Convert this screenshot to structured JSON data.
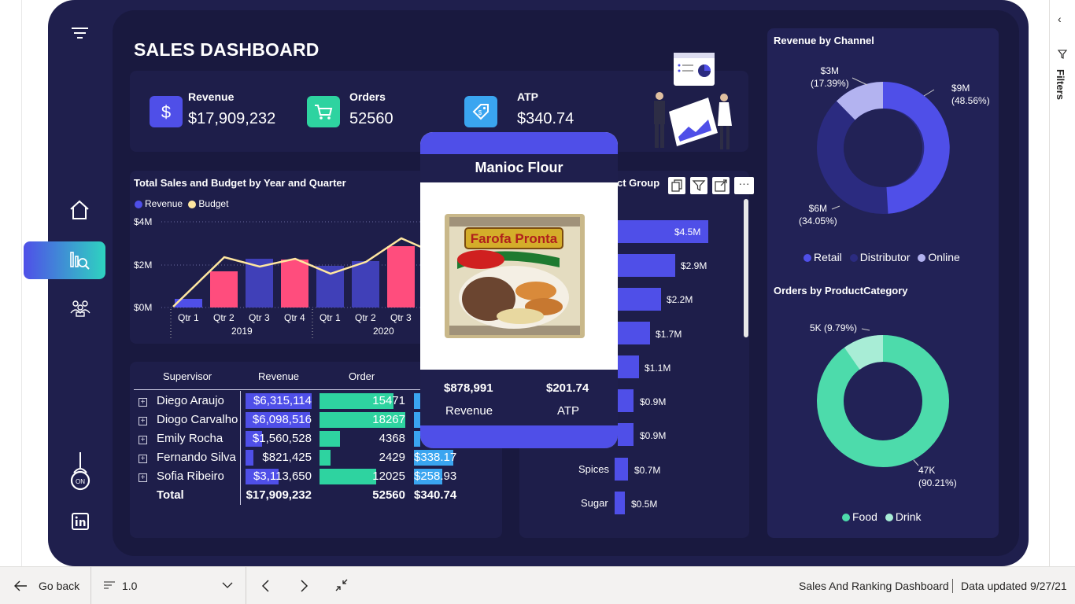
{
  "page": {
    "title": "SALES DASHBOARD"
  },
  "kpis": [
    {
      "label": "Revenue",
      "value": "$17,909,232",
      "icon": "dollar-icon",
      "color": "#4f4fe8"
    },
    {
      "label": "Orders",
      "value": "52560",
      "icon": "cart-icon",
      "color": "#2ed3a0"
    },
    {
      "label": "ATP",
      "value": "$340.74",
      "icon": "price-tag-icon",
      "color": "#3aa5f0"
    }
  ],
  "sales_chart": {
    "title": "Total Sales and Budget by Year and Quarter",
    "legend": [
      "Revenue",
      "Budget"
    ],
    "y_ticks": [
      "$4M",
      "$2M",
      "$0M"
    ],
    "quarters": [
      "Qtr 1",
      "Qtr 2",
      "Qtr 3",
      "Qtr 4",
      "Qtr 1",
      "Qtr 2",
      "Qtr 3"
    ],
    "years": [
      "2019",
      "2020"
    ]
  },
  "product_chart": {
    "title_partial": "ct Group",
    "categories": [
      "",
      "",
      "",
      "",
      "",
      "",
      "",
      "Spices",
      "Sugar"
    ],
    "value_labels": [
      "$4.5M",
      "$2.9M",
      "$2.2M",
      "$1.7M",
      "$1.1M",
      "$0.9M",
      "$0.9M",
      "$0.7M",
      "$0.5M"
    ]
  },
  "table": {
    "headers": [
      "Supervisor",
      "Revenue",
      "Order"
    ],
    "rows": [
      {
        "name": "Diego Araujo",
        "revenue": "$6,315,114",
        "order": "15471",
        "atp": ""
      },
      {
        "name": "Diogo Carvalho",
        "revenue": "$6,098,516",
        "order": "18267",
        "atp": ""
      },
      {
        "name": "Emily Rocha",
        "revenue": "$1,560,528",
        "order": "4368",
        "atp": ""
      },
      {
        "name": "Fernando Silva",
        "revenue": "$821,425",
        "order": "2429",
        "atp": "$338.17"
      },
      {
        "name": "Sofia Ribeiro",
        "revenue": "$3,113,650",
        "order": "12025",
        "atp": "$258.93"
      }
    ],
    "total": {
      "label": "Total",
      "revenue": "$17,909,232",
      "order": "52560",
      "atp": "$340.74"
    }
  },
  "tooltip": {
    "title": "Manioc Flour",
    "product_text": "Farofa Pronta",
    "revenue_value": "$878,991",
    "revenue_label": "Revenue",
    "atp_value": "$201.74",
    "atp_label": "ATP"
  },
  "channel_chart": {
    "title": "Revenue by Channel",
    "slices": [
      {
        "label": "$9M",
        "pct": "(48.56%)",
        "value": 48.56,
        "color": "#4f4fe8"
      },
      {
        "label": "$6M",
        "pct": "(34.05%)",
        "value": 34.05,
        "color": "#2b2b80"
      },
      {
        "label": "$3M",
        "pct": "(17.39%)",
        "value": 17.39,
        "color": "#b3b3f0"
      }
    ],
    "legend": [
      "Retail",
      "Distributor",
      "Online"
    ]
  },
  "category_chart": {
    "title": "Orders by ProductCategory",
    "slices": [
      {
        "label": "47K",
        "pct": "(90.21%)",
        "value": 90.21,
        "color": "#4ddbab"
      },
      {
        "label": "5K (9.79%)",
        "pct": "",
        "value": 9.79,
        "color": "#a8edd6"
      }
    ],
    "legend": [
      "Food",
      "Drink"
    ]
  },
  "statusbar": {
    "back": "Go back",
    "zoom": "1.0",
    "report_name": "Sales And Ranking Dashboard",
    "updated": "Data updated 9/27/21"
  },
  "filters": {
    "label": "Filters"
  },
  "colors": {
    "accent": "#4f4fe8",
    "pink": "#ff4d7d",
    "green": "#2ed3a0",
    "budget": "#ffe7a0"
  }
}
